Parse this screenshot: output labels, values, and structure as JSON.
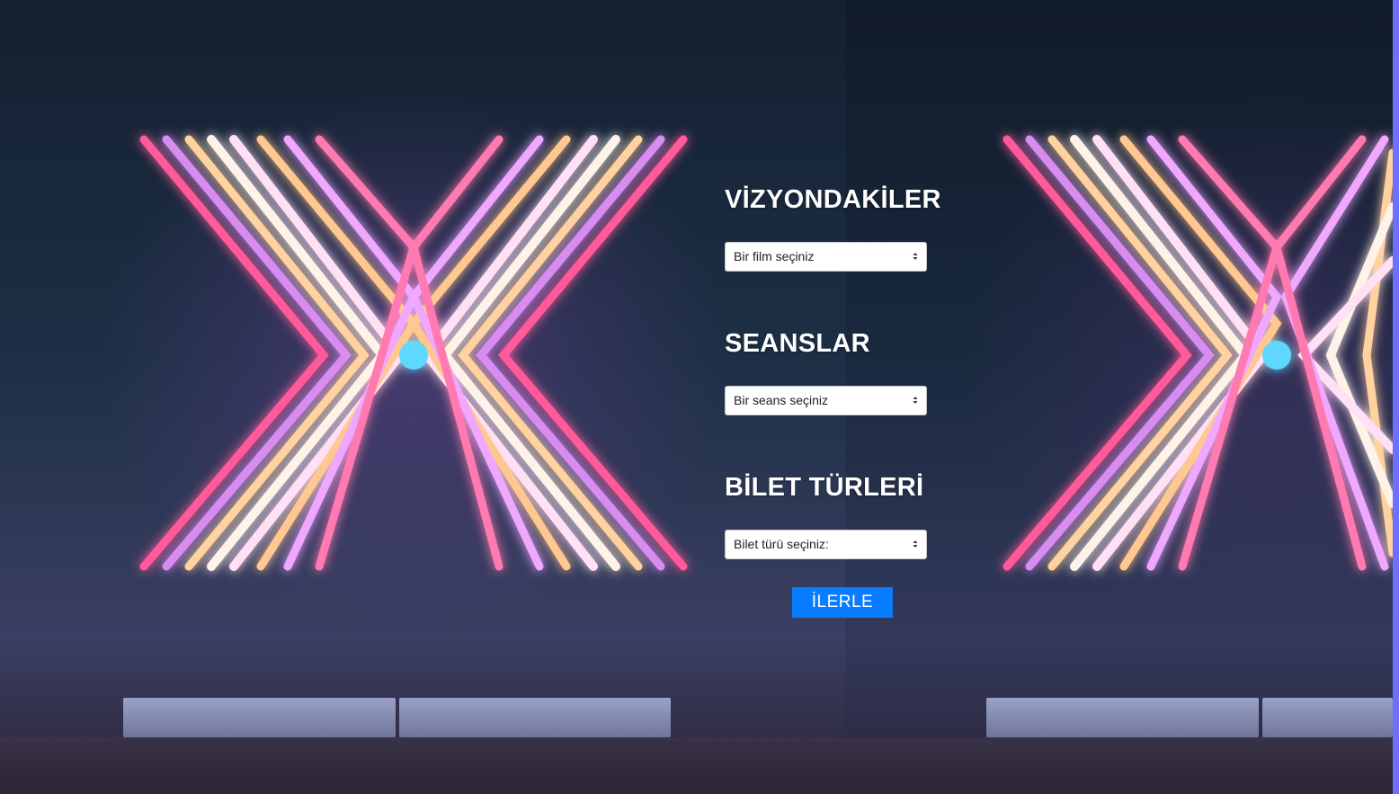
{
  "sections": [
    {
      "heading": "VİZYONDAKİLER",
      "select_value": "Bir film seçiniz"
    },
    {
      "heading": "SEANSLAR",
      "select_value": "Bir seans seçiniz"
    },
    {
      "heading": "BİLET TÜRLERİ",
      "select_value": "Bilet türü seçiniz:"
    }
  ],
  "submit_label": "İLERLE",
  "colors": {
    "button": "#0a7cff",
    "scrollbar": "#6f6fff",
    "heading_text": "#ffffff"
  },
  "icons": {
    "select_arrow": "select-arrows-icon",
    "background": "neon-x-artwork"
  }
}
